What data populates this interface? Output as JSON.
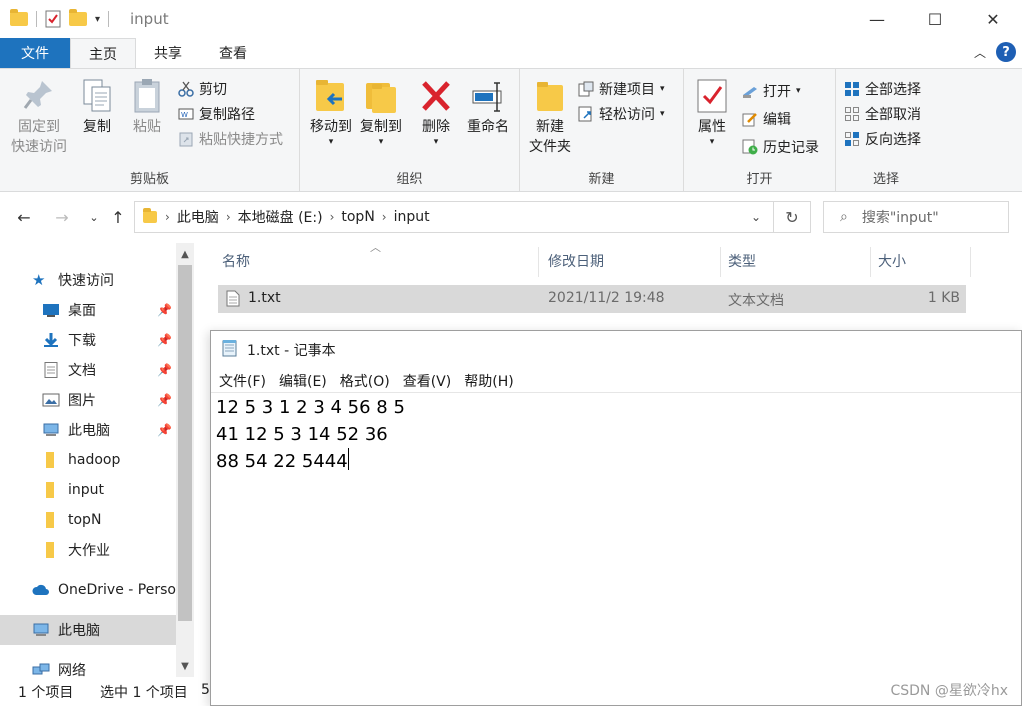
{
  "explorer": {
    "title": "input",
    "ribbon_tabs": {
      "file": "文件",
      "home": "主页",
      "share": "共享",
      "view": "查看"
    },
    "clipboard": {
      "label": "剪贴板",
      "pin": "固定到",
      "pin2": "快速访问",
      "copy": "复制",
      "paste": "粘贴",
      "cut": "剪切",
      "copy_path": "复制路径",
      "paste_shortcut": "粘贴快捷方式"
    },
    "organize": {
      "label": "组织",
      "move_to": "移动到",
      "copy_to": "复制到",
      "delete": "删除",
      "rename": "重命名"
    },
    "new_group": {
      "label": "新建",
      "new_folder": "新建",
      "new_folder2": "文件夹",
      "new_item": "新建项目",
      "easy_access": "轻松访问"
    },
    "open_group": {
      "label": "打开",
      "properties": "属性",
      "open": "打开",
      "edit": "编辑",
      "history": "历史记录"
    },
    "select_group": {
      "label": "选择",
      "select_all": "全部选择",
      "select_none": "全部取消",
      "invert": "反向选择"
    },
    "breadcrumb": [
      "此电脑",
      "本地磁盘 (E:)",
      "topN",
      "input"
    ],
    "search_placeholder": "搜索\"input\"",
    "nav": {
      "quick_access": "快速访问",
      "desktop": "桌面",
      "downloads": "下载",
      "documents": "文档",
      "pictures": "图片",
      "this_pc_pinned": "此电脑",
      "hadoop": "hadoop",
      "input": "input",
      "topn": "topN",
      "big_homework": "大作业",
      "onedrive": "OneDrive - Perso",
      "this_pc": "此电脑",
      "network": "网络"
    },
    "columns": {
      "name": "名称",
      "modified": "修改日期",
      "type": "类型",
      "size": "大小"
    },
    "files": [
      {
        "name": "1.txt",
        "modified": "2021/11/2 19:48",
        "type": "文本文档",
        "size": "1 KB"
      }
    ],
    "status": {
      "count": "1 个项目",
      "selected": "选中 1 个项目",
      "extra": "5"
    }
  },
  "notepad": {
    "title": "1.txt - 记事本",
    "menu": [
      "文件(F)",
      "编辑(E)",
      "格式(O)",
      "查看(V)",
      "帮助(H)"
    ],
    "lines": [
      "12 5 3 1 2 3 4 56 8 5",
      "41 12 5 3 14 52 36",
      "88 54 22 5444"
    ]
  },
  "watermark": "CSDN @星欲冷hx",
  "colors": {
    "accent": "#1e73be",
    "folder": "#f7c948",
    "selected_row": "#d9d9d9",
    "delete_red": "#d9232d"
  }
}
